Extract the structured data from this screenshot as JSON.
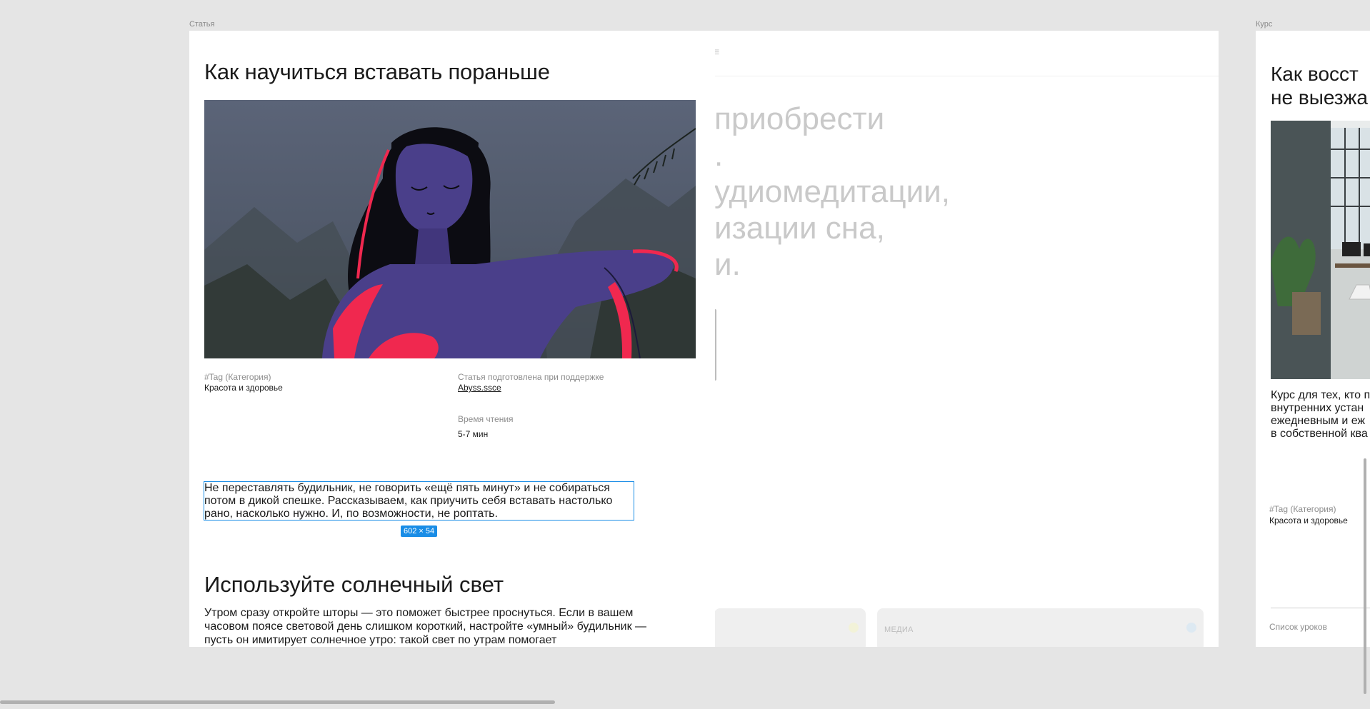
{
  "frames": {
    "article_label": "Статья",
    "course_label": "Курс"
  },
  "article": {
    "title": "Как научиться вставать пораньше",
    "tag_label": "#Tag (Категория)",
    "tag_value": "Красота и здоровье",
    "support_label": "Статья подготовлена при поддержке",
    "support_link": "Abyss.ssce",
    "reading_time_label": "Время чтения",
    "reading_time_value": "5-7 мин",
    "lead": "Не переставлять будильник, не говорить «ещё пять минут» и не собираться потом в дикой спешке. Рассказываем, как приучить себя вставать настолько рано, насколько нужно. И, по возможности, не роптать.",
    "selection_size": "602 × 54",
    "section_heading": "Используйте солнечный свет",
    "section_body": "Утром сразу откройте шторы — это поможет быстрее проснуться. Если в вашем часовом поясе световой день слишком короткий, настройте «умный» будильник — пусть он имитирует солнечное утро: такой свет по утрам помогает"
  },
  "middle": {
    "ghost_lines": [
      "приобрести",
      ".",
      "удиомедитации,",
      "изации сна,",
      "и."
    ],
    "card_label": "МЕДИА",
    "colors": {
      "dot_left": "#f2f2d8",
      "dot_right": "#dde9f2"
    }
  },
  "course": {
    "title_lines": [
      "Как восст",
      "не выезжа"
    ],
    "description_lines": [
      "Курс для тех, кто п",
      "внутренних устан",
      "ежедневным и еж",
      "в собственной ква"
    ],
    "tag_label": "#Tag (Категория)",
    "tag_value": "Красота и здоровье",
    "lessons_link": "Список уроков"
  },
  "colors": {
    "selection": "#1a8de6",
    "illustration_figure": "#4a3f8a",
    "illustration_accent": "#f0284f",
    "illustration_sky": "#5a6378"
  }
}
